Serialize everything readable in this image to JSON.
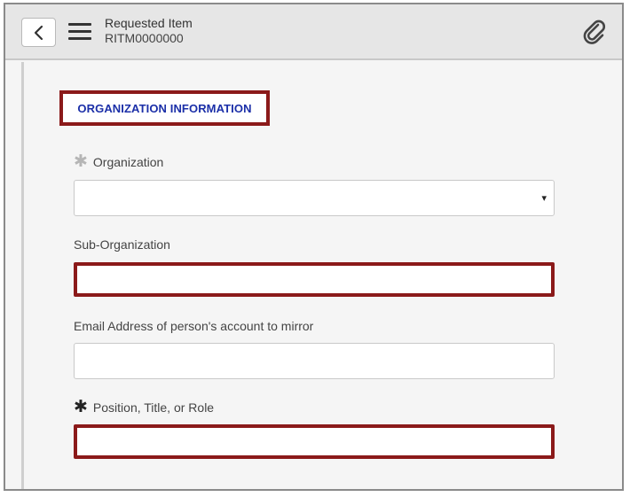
{
  "header": {
    "title": "Requested Item",
    "number": "RITM0000000",
    "back_icon": "chevron-left-icon",
    "menu_icon": "hamburger-menu-icon",
    "attach_icon": "paperclip-icon"
  },
  "section": {
    "title": "ORGANIZATION INFORMATION"
  },
  "fields": {
    "organization": {
      "label": "Organization",
      "value": "",
      "required": true,
      "arrow": "▾"
    },
    "sub_organization": {
      "label": "Sub-Organization",
      "value": ""
    },
    "email_mirror": {
      "label": "Email Address of person's account to mirror",
      "value": ""
    },
    "position": {
      "label": "Position, Title, or Role",
      "value": "",
      "required": true
    }
  },
  "colors": {
    "highlight_border": "#8b1a1a",
    "section_text": "#1b2fa8"
  }
}
